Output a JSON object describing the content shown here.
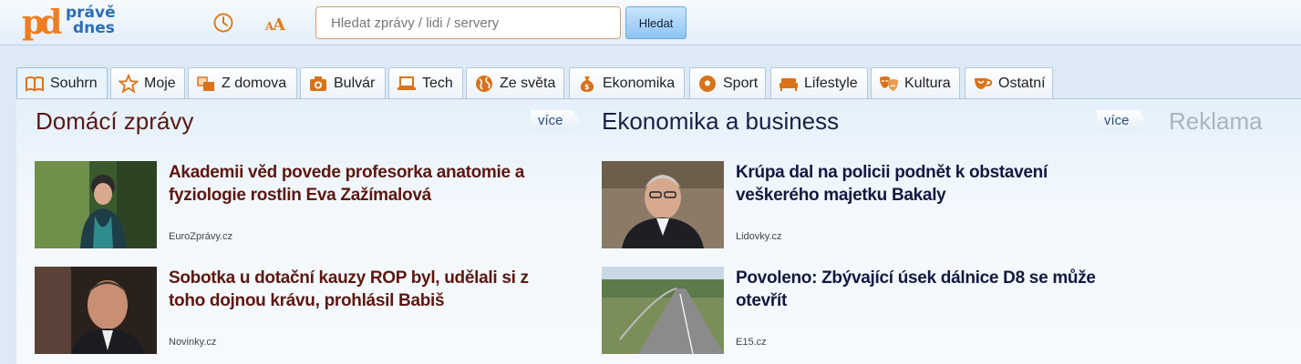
{
  "logo": {
    "mark": "pd",
    "line1": "právě",
    "line2": "dnes"
  },
  "header": {
    "clock_icon": "clock-icon",
    "font_icon": "font-size-icon"
  },
  "search": {
    "placeholder": "Hledat zprávy / lidi / servery",
    "button": "Hledat"
  },
  "tabs": [
    {
      "label": "Souhrn",
      "icon": "book-icon",
      "active": true
    },
    {
      "label": "Moje",
      "icon": "star-icon"
    },
    {
      "label": "Z domova",
      "icon": "map-icon"
    },
    {
      "label": "Bulvár",
      "icon": "camera-icon"
    },
    {
      "label": "Tech",
      "icon": "laptop-icon"
    },
    {
      "label": "Ze světa",
      "icon": "globe-icon"
    },
    {
      "label": "Ekonomika",
      "icon": "money-bag-icon"
    },
    {
      "label": "Sport",
      "icon": "ball-icon"
    },
    {
      "label": "Lifestyle",
      "icon": "sofa-icon"
    },
    {
      "label": "Kultura",
      "icon": "masks-icon"
    },
    {
      "label": "Ostatní",
      "icon": "cup-icon"
    }
  ],
  "colors": {
    "accent": "#f07d1e",
    "brand_blue": "#2a6eb5",
    "domestic_headline": "#5c1710",
    "economy_headline": "#14183f"
  },
  "sections": {
    "domestic": {
      "title": "Domácí zprávy",
      "more": "více",
      "articles": [
        {
          "headline": "Akademii věd povede profesorka anatomie a fyziologie rostlin Eva Zažímalová",
          "source": "EuroZprávy.cz"
        },
        {
          "headline": "Sobotka u dotační kauzy ROP byl, udělali si z toho dojnou krávu, prohlásil Babiš",
          "source": "Novinky.cz"
        }
      ]
    },
    "economy": {
      "title": "Ekonomika a business",
      "more": "více",
      "articles": [
        {
          "headline": "Krúpa dal na policii podnět k obstavení veškerého majetku Bakaly",
          "source": "Lidovky.cz"
        },
        {
          "headline": "Povoleno: Zbývající úsek dálnice D8 se může otevřít",
          "source": "E15.cz"
        }
      ]
    }
  },
  "ad_label": "Reklama"
}
